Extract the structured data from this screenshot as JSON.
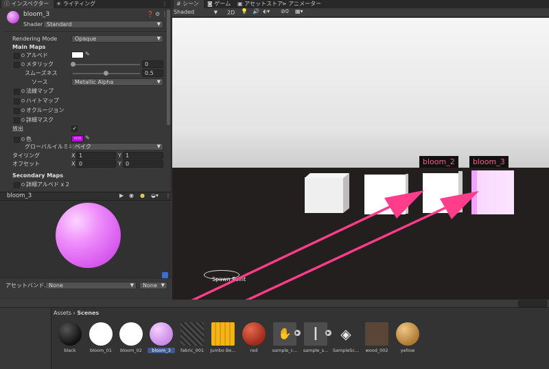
{
  "tabs_left": [
    {
      "label": "インスペクター",
      "icon": "info-icon"
    },
    {
      "label": "ライティング",
      "icon": "light-icon"
    }
  ],
  "tabs_right": [
    {
      "label": "シーン",
      "icon": "grid-icon"
    },
    {
      "label": "ゲーム",
      "icon": "gamepad-icon"
    },
    {
      "label": "アセットストア",
      "icon": "store-icon"
    },
    {
      "label": "アニメーター",
      "icon": "animator-icon"
    }
  ],
  "inspector": {
    "material_name": "bloom_3",
    "shader_label": "Shader",
    "shader_value": "Standard",
    "rendering_mode_label": "Rendering Mode",
    "rendering_mode_value": "Opaque",
    "main_maps": "Main Maps",
    "albedo": "アルベド",
    "metallic": "メタリック",
    "metallic_value": "0",
    "smoothness": "スムーズネス",
    "smoothness_value": "0.5",
    "source": "ソース",
    "source_value": "Metallic Alpha",
    "normal_map": "法線マップ",
    "height_map": "ハイトマップ",
    "occlusion": "オクルージョン",
    "detail_mask": "詳細マスク",
    "emission": "放出",
    "color": "色",
    "hdr_badge": "HDR",
    "global_illumination": "グローバルイルミネーシ",
    "global_illumination_value": "ベイク",
    "tiling": "タイリング",
    "offset": "オフセット",
    "tiling_x": "1",
    "tiling_y": "1",
    "offset_x": "0",
    "offset_y": "0",
    "axis_x": "X",
    "axis_y": "Y",
    "secondary_maps": "Secondary Maps",
    "detail_albedo": "詳細アルベド x 2"
  },
  "preview": {
    "title": "bloom_3",
    "asset_bundle_label": "アセットバンドル",
    "bundle_value": "None",
    "variant_value": "None"
  },
  "scene": {
    "shading_mode": "Shaded",
    "mode_2d": "2D",
    "gizmo_count": "0",
    "spawn_point": "Spawn Point",
    "label_bloom_2": "bloom_2",
    "label_bloom_3": "bloom_3"
  },
  "project": {
    "breadcrumb_root": "Assets",
    "breadcrumb_sep": "›",
    "breadcrumb_current": "Scenes",
    "assets": [
      {
        "name": "black",
        "color": "#1e1e1e"
      },
      {
        "name": "bloom_01",
        "color": "#ffffff"
      },
      {
        "name": "bloom_02",
        "color": "#ffffff"
      },
      {
        "name": "bloom_3",
        "color": "#d98cf0"
      },
      {
        "name": "fabric_001",
        "color": "#3b3b3b"
      },
      {
        "name": "Jumbo Be...",
        "color": "#f2b417"
      },
      {
        "name": "red",
        "color": "#c0392b"
      },
      {
        "name": "sample_c...",
        "color": "#555555"
      },
      {
        "name": "sample_s...",
        "color": "#555555"
      },
      {
        "name": "SampleSc...",
        "color": "#444444"
      },
      {
        "name": "wood_002",
        "color": "#5a4636"
      },
      {
        "name": "yellow",
        "color": "#c59348"
      }
    ]
  },
  "colors": {
    "accent_pink": "#ff3d8b",
    "material_pink": "#e680f5",
    "panel": "#383838"
  }
}
